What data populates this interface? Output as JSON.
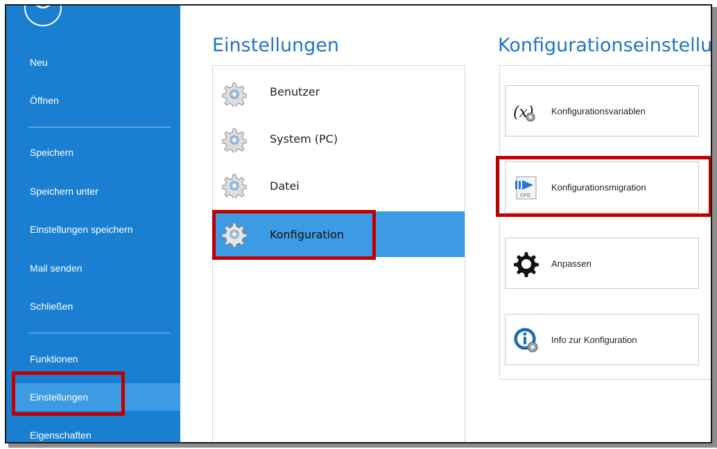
{
  "sidebar": {
    "items": [
      {
        "label": "Neu"
      },
      {
        "label": "Öffnen"
      },
      {
        "label": "Speichern"
      },
      {
        "label": "Speichern unter"
      },
      {
        "label": "Einstellungen speichern"
      },
      {
        "label": "Mail senden"
      },
      {
        "label": "Schließen"
      },
      {
        "label": "Funktionen"
      },
      {
        "label": "Einstellungen",
        "active": true
      },
      {
        "label": "Eigenschaften"
      }
    ]
  },
  "settings": {
    "title": "Einstellungen",
    "items": [
      {
        "label": "Benutzer"
      },
      {
        "label": "System (PC)"
      },
      {
        "label": "Datei"
      },
      {
        "label": "Konfiguration",
        "selected": true
      }
    ]
  },
  "config": {
    "title": "Konfigurationseinstellu",
    "tiles": [
      {
        "label": "Konfigurationsvariablen",
        "icon": "variable-x-gear-icon"
      },
      {
        "label": "Konfigurationsmigration",
        "icon": "cfg-migration-icon",
        "icon_text": "CFG"
      },
      {
        "label": "Anpassen",
        "icon": "gear-icon"
      },
      {
        "label": "Info zur Konfiguration",
        "icon": "info-gear-icon"
      }
    ]
  },
  "colors": {
    "sidebar_bg": "#1a7fd1",
    "active_bg": "#3d9be3",
    "title_blue": "#2274c4",
    "highlight_red": "#c00000"
  }
}
